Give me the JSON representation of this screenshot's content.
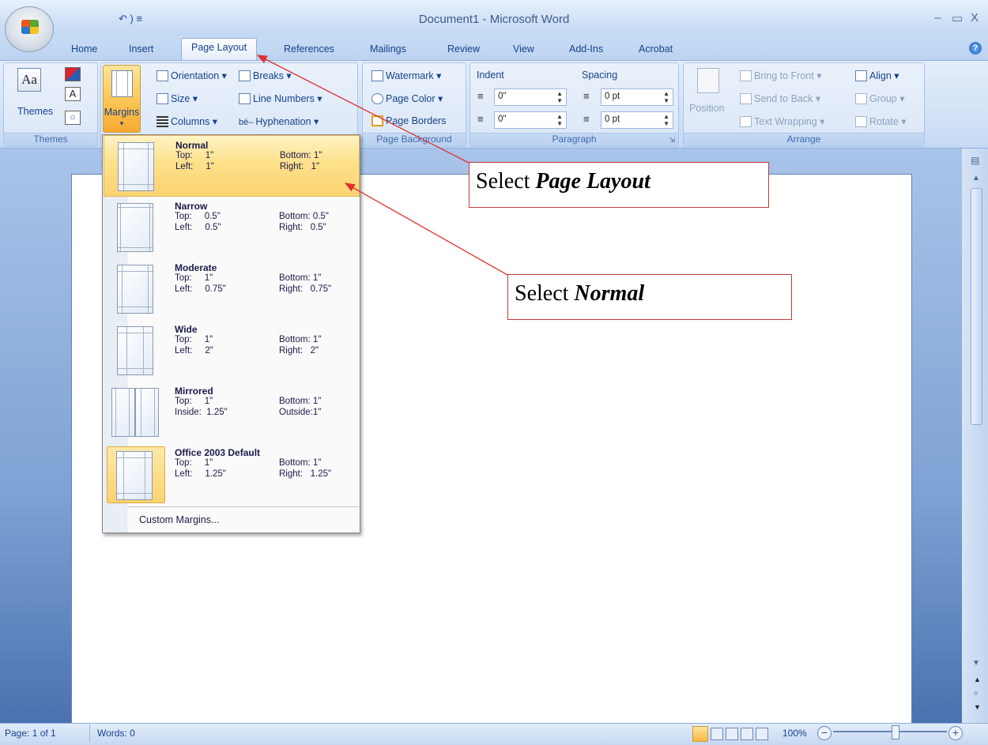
{
  "window": {
    "title": "Document1 - Microsoft Word",
    "qat": "↶  ) ≡",
    "minimize": "–",
    "maximize": "▭",
    "close": "X"
  },
  "tabs": [
    "Home",
    "Insert",
    "Page Layout",
    "References",
    "Mailings",
    "Review",
    "View",
    "Add-Ins",
    "Acrobat"
  ],
  "help": "?",
  "ribbon": {
    "themes": {
      "label": "Themes",
      "group": "Themes",
      "aa": "Aa",
      "a": "A"
    },
    "page_setup": {
      "margins": "Margins",
      "orientation": "Orientation ▾",
      "size": "Size ▾",
      "columns": "Columns ▾",
      "breaks": "Breaks ▾",
      "line_numbers": "Line Numbers ▾",
      "hyphenation": "Hyphenation ▾"
    },
    "page_background": {
      "group": "Page Background",
      "watermark": "Watermark ▾",
      "page_color": "Page Color ▾",
      "page_borders": "Page Borders"
    },
    "paragraph": {
      "group": "Paragraph",
      "indent": "Indent",
      "spacing": "Spacing",
      "indent_left": "0\"",
      "indent_right": "0\"",
      "spacing_before": "0 pt",
      "spacing_after": "0 pt"
    },
    "arrange": {
      "group": "Arrange",
      "position": "Position",
      "bring_to_front": "Bring to Front ▾",
      "send_to_back": "Send to Back ▾",
      "text_wrapping": "Text Wrapping ▾",
      "align": "Align ▾",
      "group_btn": "Group ▾",
      "rotate": "Rotate ▾"
    }
  },
  "margins_menu": {
    "items": [
      {
        "name": "Normal",
        "top": "Top:     1\"",
        "bottom": "Bottom: 1\"",
        "left": "Left:     1\"",
        "right": "Right:   1\""
      },
      {
        "name": "Narrow",
        "top": "Top:     0.5\"",
        "bottom": "Bottom: 0.5\"",
        "left": "Left:     0.5\"",
        "right": "Right:   0.5\""
      },
      {
        "name": "Moderate",
        "top": "Top:     1\"",
        "bottom": "Bottom: 1\"",
        "left": "Left:     0.75\"",
        "right": "Right:   0.75\""
      },
      {
        "name": "Wide",
        "top": "Top:     1\"",
        "bottom": "Bottom: 1\"",
        "left": "Left:     2\"",
        "right": "Right:   2\""
      },
      {
        "name": "Mirrored",
        "top": "Top:     1\"",
        "bottom": "Bottom: 1\"",
        "left": "Inside:  1.25\"",
        "right": "Outside:1\""
      },
      {
        "name": "Office 2003 Default",
        "top": "Top:     1\"",
        "bottom": "Bottom: 1\"",
        "left": "Left:     1.25\"",
        "right": "Right:   1.25\""
      }
    ],
    "custom": "Custom Margins..."
  },
  "callouts": {
    "first_prefix": "Select ",
    "first_bold": "Page Layout",
    "second_prefix": "Select ",
    "second_bold": "Normal"
  },
  "status": {
    "page": "Page: 1 of 1",
    "words": "Words: 0",
    "zoom": "100%"
  },
  "colors": {
    "accent": "#15428b",
    "hover": "#fbd372",
    "callout_border": "#c13b3b",
    "arrow": "#e03030"
  }
}
